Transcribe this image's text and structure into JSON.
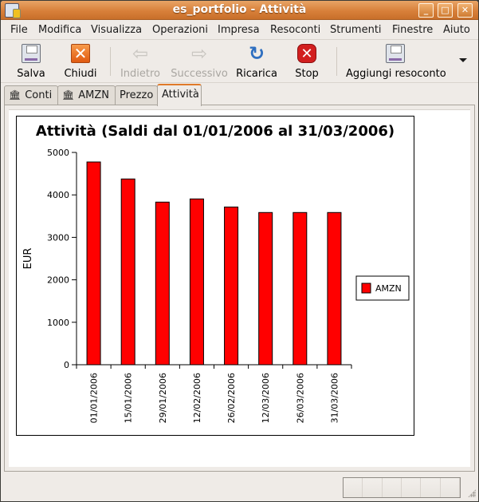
{
  "window": {
    "title": "es_portfolio - Attività",
    "controls": [
      "minimize",
      "maximize",
      "close"
    ]
  },
  "menubar": {
    "items": [
      {
        "label": "File",
        "mnemonic": "F"
      },
      {
        "label": "Modifica",
        "mnemonic": "M"
      },
      {
        "label": "Visualizza",
        "mnemonic": "V"
      },
      {
        "label": "Operazioni",
        "mnemonic": "O"
      },
      {
        "label": "Impresa",
        "mnemonic": "a"
      },
      {
        "label": "Resoconti",
        "mnemonic": "R"
      },
      {
        "label": "Strumenti",
        "mnemonic": "S"
      },
      {
        "label": "Finestre",
        "mnemonic": "n"
      },
      {
        "label": "Aiuto",
        "mnemonic": "j"
      }
    ]
  },
  "toolbar": {
    "save": {
      "label": "Salva",
      "icon": "floppy-icon",
      "enabled": true
    },
    "close": {
      "label": "Chiudi",
      "icon": "close-icon",
      "enabled": true
    },
    "back": {
      "label": "Indietro",
      "icon": "arrow-left-icon",
      "enabled": false
    },
    "forward": {
      "label": "Successivo",
      "icon": "arrow-right-icon",
      "enabled": false
    },
    "reload": {
      "label": "Ricarica",
      "icon": "reload-icon",
      "enabled": true
    },
    "stop": {
      "label": "Stop",
      "icon": "stop-icon",
      "enabled": true
    },
    "add_report": {
      "label": "Aggiungi resoconto",
      "icon": "floppy-icon",
      "enabled": true
    },
    "overflow_icon": "chevron-down-icon"
  },
  "tabs": [
    {
      "label": "Conti",
      "icon": "bank-icon",
      "active": false
    },
    {
      "label": "AMZN",
      "icon": "bank-icon",
      "active": false
    },
    {
      "label": "Prezzo",
      "icon": "",
      "active": false
    },
    {
      "label": "Attività",
      "icon": "",
      "active": true
    }
  ],
  "colors": {
    "titlebar": "#d8803a",
    "bar_fill": "#ff0000",
    "active_tab_accent": "#e07a2a"
  },
  "chart_data": {
    "type": "bar",
    "title": "Attività (Saldi dal 01/01/2006 al 31/03/2006)",
    "xlabel": "",
    "ylabel": "EUR",
    "ylim": [
      0,
      5000
    ],
    "yticks": [
      0,
      1000,
      2000,
      3000,
      4000,
      5000
    ],
    "categories": [
      "01/01/2006",
      "15/01/2006",
      "29/01/2006",
      "12/02/2006",
      "26/02/2006",
      "12/03/2006",
      "26/03/2006",
      "31/03/2006"
    ],
    "series": [
      {
        "name": "AMZN",
        "color": "#ff0000",
        "values": [
          4775,
          4375,
          3830,
          3905,
          3715,
          3585,
          3585,
          3585
        ]
      }
    ],
    "legend": {
      "position": "right",
      "entries": [
        "AMZN"
      ]
    },
    "grid": false
  }
}
